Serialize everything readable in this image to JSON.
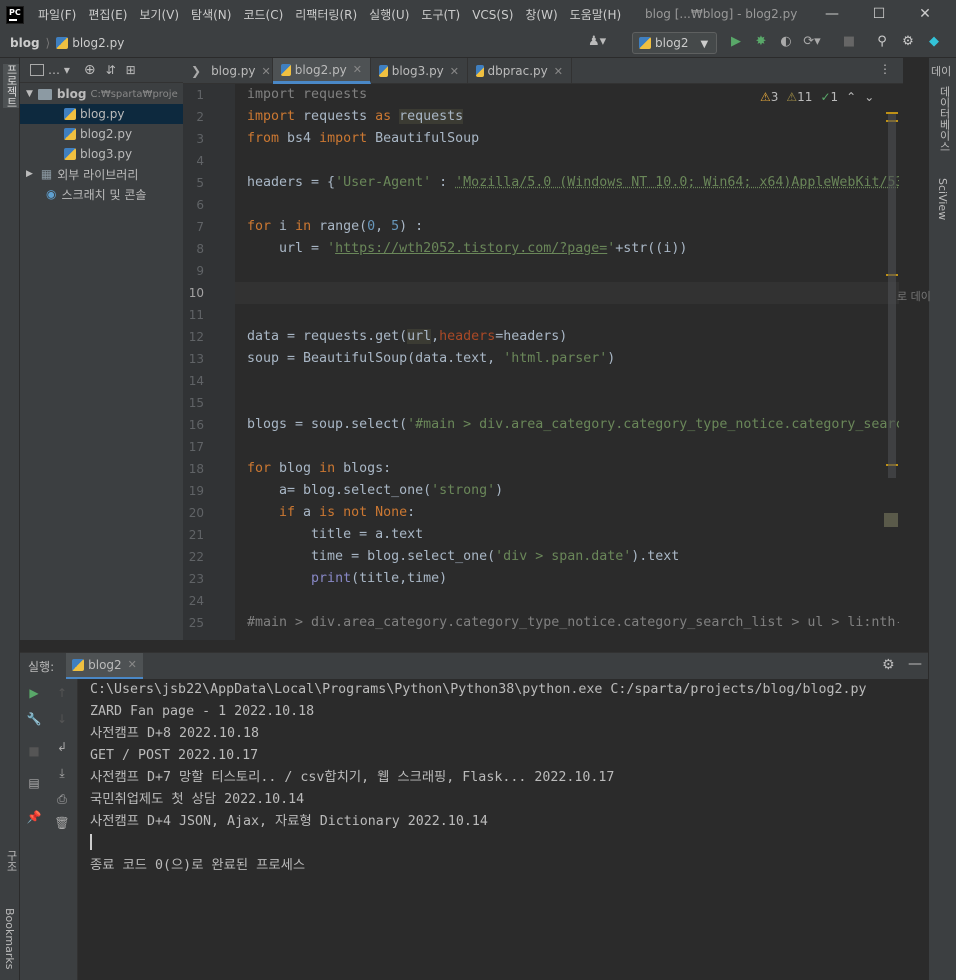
{
  "menu": {
    "logo": "PC",
    "items": [
      "파일(F)",
      "편집(E)",
      "보기(V)",
      "탐색(N)",
      "코드(C)",
      "리팩터링(R)",
      "실행(U)",
      "도구(T)",
      "VCS(S)",
      "창(W)",
      "도움말(H)"
    ],
    "window_title": "blog [...₩blog] - blog2.py"
  },
  "nav": {
    "project": "blog",
    "file": "blog2.py",
    "run_config": "blog2"
  },
  "left_strip": {
    "project_label": "프로젝트",
    "structure_label": "구조",
    "bookmarks_label": "Bookmarks"
  },
  "right_strip": {
    "db_label": "데이터베이스",
    "sciview_label": "SciView",
    "cut_label": "데이",
    "cut_label2": "로 데이"
  },
  "project_panel": {
    "root_name": "blog",
    "root_path": "C:₩sparta₩proje",
    "files": [
      "blog.py",
      "blog2.py",
      "blog3.py"
    ],
    "external": "외부 라이브러리",
    "scratch": "스크래치 및 콘솔"
  },
  "tabs": [
    "blog.py",
    "blog2.py",
    "blog3.py",
    "dbprac.py"
  ],
  "inspections": {
    "warnings": "3",
    "weak": "11",
    "ok": "1"
  },
  "run": {
    "label": "실행:",
    "tab": "blog2"
  },
  "console": [
    "C:\\Users\\jsb22\\AppData\\Local\\Programs\\Python\\Python38\\python.exe C:/sparta/projects/blog/blog2.py",
    "ZARD Fan page - 1 2022.10.18",
    "사전캠프 D+8 2022.10.18",
    "GET / POST 2022.10.17",
    "사전캠프 D+7 망할 티스토리.. / csv합치기, 웹 스크래핑, Flask... 2022.10.17",
    "국민취업제도 첫 상담 2022.10.14",
    "사전캠프 D+4 JSON, Ajax, 자료형 Dictionary 2022.10.14",
    "",
    "종료 코드 0(으)로 완료된 프로세스"
  ],
  "line_numbers": [
    "1",
    "2",
    "3",
    "4",
    "5",
    "6",
    "7",
    "8",
    "9",
    "10",
    "11",
    "12",
    "13",
    "14",
    "15",
    "16",
    "17",
    "18",
    "19",
    "20",
    "21",
    "22",
    "23",
    "24",
    "25"
  ]
}
